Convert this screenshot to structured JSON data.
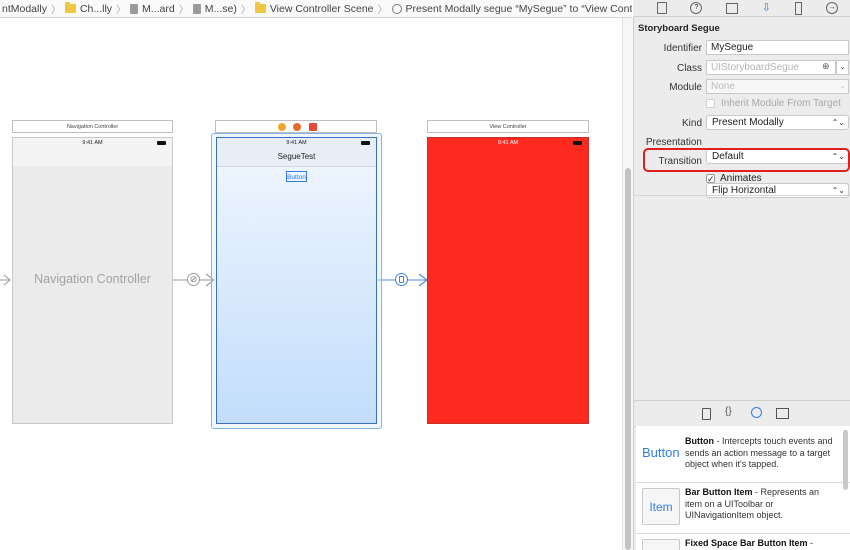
{
  "breadcrumb": [
    {
      "label": "ntModally",
      "icon": "none"
    },
    {
      "label": "Ch...lly",
      "icon": "folder-icon"
    },
    {
      "label": "M...ard",
      "icon": "storyboard-file-icon"
    },
    {
      "label": "M...se)",
      "icon": "storyboard-file-icon"
    },
    {
      "label": "View Controller Scene",
      "icon": "folder-icon"
    },
    {
      "label": "Present Modally segue “MySegue” to “View Controller”",
      "icon": "segue-icon"
    }
  ],
  "canvas": {
    "nav_scene": {
      "title": "Navigation Controller",
      "time": "9:41 AM",
      "body_label": "Navigation Controller"
    },
    "segue_scene": {
      "time": "9:41 AM",
      "nav_title": "SegueTest",
      "button_label": "Button"
    },
    "vc_scene": {
      "title": "View Controller",
      "time": "9:41 AM",
      "background": "#ff2a1f"
    }
  },
  "inspector": {
    "section_title": "Storyboard Segue",
    "identifier": {
      "label": "Identifier",
      "value": "MySegue"
    },
    "class": {
      "label": "Class",
      "placeholder": "UIStoryboardSegue"
    },
    "module": {
      "label": "Module",
      "placeholder": "None"
    },
    "inherit_module": {
      "label": "Inherit Module From Target",
      "checked": false
    },
    "kind": {
      "label": "Kind",
      "value": "Present Modally"
    },
    "presentation": {
      "label": "Presentation",
      "value": "Default"
    },
    "transition": {
      "label": "Transition",
      "value": "Flip Horizontal",
      "highlight_color": "#e0201e"
    },
    "animates": {
      "label": "Animates",
      "checked": true
    }
  },
  "library": {
    "items": [
      {
        "icon_text": "Button",
        "name": "Button",
        "description": " - Intercepts touch events and sends an action message to a target object when it's tapped."
      },
      {
        "icon_text": "Item",
        "name": "Bar Button Item",
        "description": " - Represents an item on a UIToolbar or UINavigationItem object."
      },
      {
        "icon_text": "",
        "name": "Fixed Space Bar Button Item",
        "description": " -"
      }
    ]
  }
}
